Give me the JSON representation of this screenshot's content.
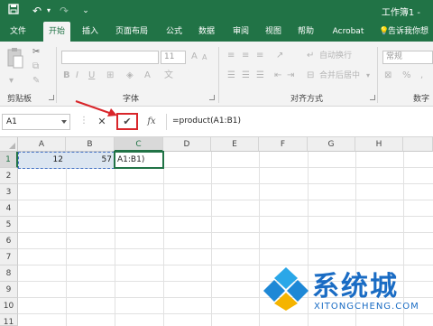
{
  "title_bar": {
    "title": "工作簿1 -",
    "save_icon": "save-icon",
    "undo_icon": "undo-icon",
    "redo_icon": "redo-icon",
    "more_icon": "customize-qat-icon"
  },
  "tabs": [
    {
      "label": "文件"
    },
    {
      "label": "开始",
      "active": true
    },
    {
      "label": "插入"
    },
    {
      "label": "页面布局"
    },
    {
      "label": "公式"
    },
    {
      "label": "数据"
    },
    {
      "label": "审阅"
    },
    {
      "label": "视图"
    },
    {
      "label": "帮助"
    },
    {
      "label": "Acrobat"
    },
    {
      "label": "告诉我你想"
    }
  ],
  "ribbon": {
    "clipboard_label": "剪贴板",
    "font_label": "字体",
    "font_size": "11",
    "alignment_label": "对齐方式",
    "wrap_text": "自动换行",
    "merge_center": "合并后居中",
    "number_label": "数字",
    "number_format": "常规"
  },
  "formula_bar": {
    "name_box": "A1",
    "cancel_glyph": "✕",
    "enter_glyph": "✔",
    "fx_glyph": "fx",
    "formula": "=product(A1:B1)"
  },
  "sheet": {
    "columns": [
      "A",
      "B",
      "C",
      "D",
      "E",
      "F",
      "G",
      "H"
    ],
    "rows": [
      "1",
      "2",
      "3",
      "4",
      "5",
      "6",
      "7",
      "8",
      "9",
      "10",
      "11"
    ],
    "cells": {
      "A1": "12",
      "B1": "57",
      "C1": "A1:B1)"
    }
  },
  "watermark": {
    "text": "系统城",
    "sub": "XITONGCHENG.COM"
  },
  "colors": {
    "accent": "#217346",
    "annotation_red": "#d9262b",
    "watermark_blue": "#1a6cc4"
  }
}
